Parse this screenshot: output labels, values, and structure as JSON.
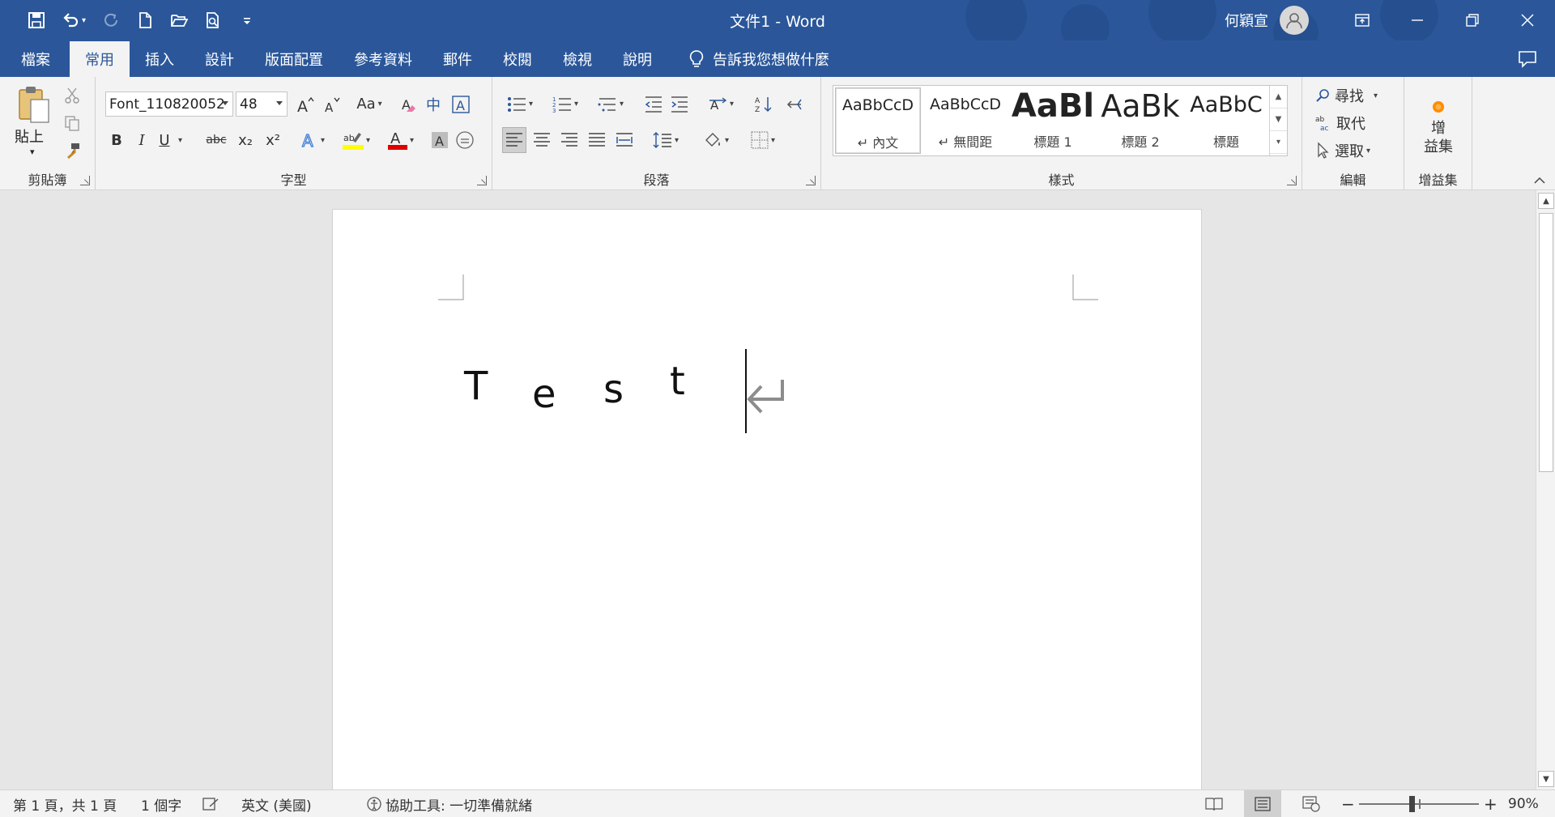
{
  "window": {
    "title": "文件1  -  Word",
    "user": "何穎宣"
  },
  "tabs": [
    {
      "label": "檔案"
    },
    {
      "label": "常用",
      "active": true
    },
    {
      "label": "插入"
    },
    {
      "label": "設計"
    },
    {
      "label": "版面配置"
    },
    {
      "label": "參考資料"
    },
    {
      "label": "郵件"
    },
    {
      "label": "校閱"
    },
    {
      "label": "檢視"
    },
    {
      "label": "說明"
    }
  ],
  "tell_me": "告訴我您想做什麼",
  "ribbon": {
    "clipboard": {
      "label": "剪貼簿",
      "paste": "貼上"
    },
    "font": {
      "label": "字型",
      "font_name": "Font_110820052",
      "font_size": "48",
      "change_case": "Aa",
      "phonetic": "中",
      "bold": "B",
      "italic": "I",
      "underline": "U",
      "strike": "abc",
      "subscript": "x₂",
      "superscript": "x²"
    },
    "paragraph": {
      "label": "段落"
    },
    "styles": {
      "label": "樣式",
      "items": [
        {
          "sample": "AaBbCcD",
          "name": "↵ 內文"
        },
        {
          "sample": "AaBbCcD",
          "name": "↵ 無間距"
        },
        {
          "sample": "AaBl",
          "name": "標題 1"
        },
        {
          "sample": "AaBk",
          "name": "標題 2"
        },
        {
          "sample": "AaBbC",
          "name": "標題"
        }
      ]
    },
    "editing": {
      "label": "編輯",
      "find": "尋找",
      "replace": "取代",
      "select": "選取"
    },
    "addins": {
      "label": "增益集",
      "button": "增\n益集"
    }
  },
  "document": {
    "letters": [
      "T",
      "e",
      "s",
      "t"
    ]
  },
  "status": {
    "page": "第 1 頁，共 1 頁",
    "words": "1 個字",
    "language": "英文 (美國)",
    "accessibility": "協助工具: 一切準備就緒",
    "zoom": "90%"
  },
  "colors": {
    "accent": "#2b579a",
    "highlight": "#ffff00",
    "font_color": "#e00000",
    "addin_dot": "#ff8c00"
  }
}
